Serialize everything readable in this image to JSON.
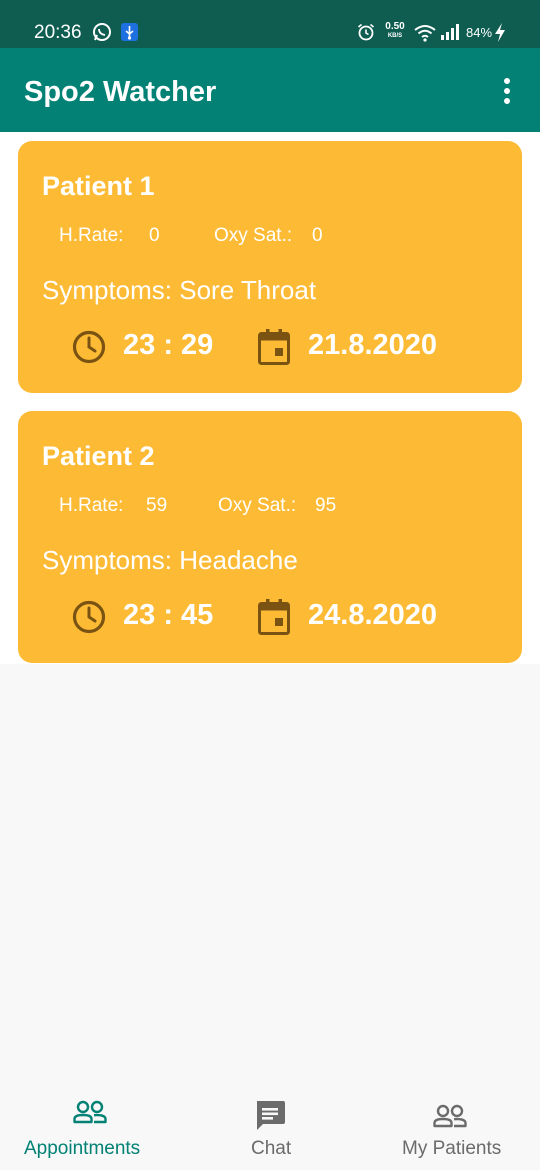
{
  "status_bar": {
    "time": "20:36",
    "network_speed": "0.50",
    "network_speed_unit": "KB/S",
    "battery": "84%",
    "icons": [
      "whatsapp-icon",
      "usb-icon",
      "alarm-icon",
      "wifi-icon",
      "signal-icon",
      "charging-icon"
    ]
  },
  "app_bar": {
    "title": "Spo2 Watcher",
    "menu_icon": "overflow-menu-icon"
  },
  "patients": [
    {
      "name": "Patient 1",
      "hr_label": "H.Rate:",
      "hr_value": "0",
      "oxy_label": "Oxy Sat.:",
      "oxy_value": "0",
      "symptoms": "Symptoms: Sore Throat",
      "time": "23 : 29",
      "date": "21.8.2020"
    },
    {
      "name": "Patient 2",
      "hr_label": "H.Rate:",
      "hr_value": "59",
      "oxy_label": "Oxy Sat.:",
      "oxy_value": "95",
      "symptoms": "Symptoms: Headache",
      "time": "23 : 45",
      "date": "24.8.2020"
    }
  ],
  "bottom_nav": {
    "items": [
      {
        "label": "Appointments",
        "icon": "people-icon",
        "active": true
      },
      {
        "label": "Chat",
        "icon": "chat-icon",
        "active": false
      },
      {
        "label": "My Patients",
        "icon": "people-icon",
        "active": false
      }
    ]
  },
  "colors": {
    "status_bar": "#0f5d51",
    "app_bar": "#028174",
    "card": "#fdbb35",
    "card_icon": "#7a5312",
    "nav_active": "#028174",
    "nav_inactive": "#6b6b6b",
    "background": "#f8f8f8"
  }
}
